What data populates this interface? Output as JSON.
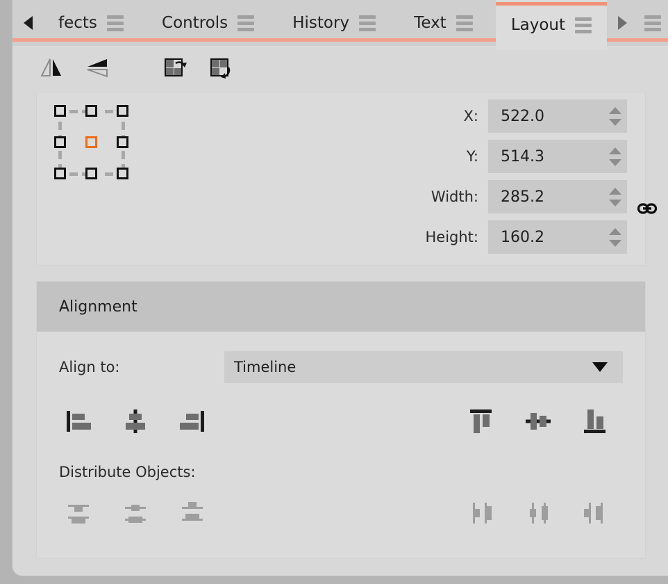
{
  "tabbar": {
    "prev_arrow_icon": "triangle-left-icon",
    "next_arrow_icon": "triangle-right-icon",
    "tabs": [
      {
        "label": "fects",
        "menu_icon": "hamburger-menu-icon",
        "active": false
      },
      {
        "label": "Controls",
        "menu_icon": "hamburger-menu-icon",
        "active": false
      },
      {
        "label": "History",
        "menu_icon": "hamburger-menu-icon",
        "active": false
      },
      {
        "label": "Text",
        "menu_icon": "hamburger-menu-icon",
        "active": false
      },
      {
        "label": "Layout",
        "menu_icon": "hamburger-menu-icon",
        "active": true
      }
    ],
    "overflow_menu_icon": "hamburger-menu-icon",
    "accent_color": "#f2907a"
  },
  "transform_toolbar": {
    "buttons": [
      {
        "name": "flip-horizontal-button",
        "icon": "flip-horizontal-icon"
      },
      {
        "name": "flip-vertical-button",
        "icon": "flip-vertical-icon"
      },
      {
        "name": "rotate-clockwise-button",
        "icon": "rotate-cw-icon"
      },
      {
        "name": "rotate-counterclockwise-button",
        "icon": "rotate-ccw-icon"
      }
    ]
  },
  "transform_panel": {
    "anchor": {
      "selected": "center",
      "selected_color": "#ef6c15",
      "cells": [
        "top-left",
        "top-center",
        "top-right",
        "middle-left",
        "center",
        "middle-right",
        "bottom-left",
        "bottom-center",
        "bottom-right"
      ]
    },
    "fields": [
      {
        "label": "X:",
        "value": "522.0",
        "name": "x-field"
      },
      {
        "label": "Y:",
        "value": "514.3",
        "name": "y-field"
      },
      {
        "label": "Width:",
        "value": "285.2",
        "name": "width-field"
      },
      {
        "label": "Height:",
        "value": "160.2",
        "name": "height-field"
      }
    ],
    "link_icon": "chain-link-icon"
  },
  "alignment": {
    "title": "Alignment",
    "align_to_label": "Align to:",
    "align_to_value": "Timeline",
    "dropdown_icon": "chevron-down-icon",
    "align_buttons_left": [
      {
        "name": "align-left-button",
        "icon": "align-left-icon"
      },
      {
        "name": "align-horizontal-center-button",
        "icon": "align-center-horizontal-icon"
      },
      {
        "name": "align-right-button",
        "icon": "align-right-icon"
      }
    ],
    "align_buttons_right": [
      {
        "name": "align-top-button",
        "icon": "align-top-icon"
      },
      {
        "name": "align-vertical-center-button",
        "icon": "align-center-vertical-icon"
      },
      {
        "name": "align-bottom-button",
        "icon": "align-bottom-icon"
      }
    ],
    "distribute_label": "Distribute Objects:",
    "distribute_buttons_left": [
      {
        "name": "distribute-top-edges-button",
        "icon": "distribute-top-icon",
        "disabled": true
      },
      {
        "name": "distribute-vertical-centers-button",
        "icon": "distribute-middle-icon",
        "disabled": true
      },
      {
        "name": "distribute-bottom-edges-button",
        "icon": "distribute-bottom-icon",
        "disabled": true
      }
    ],
    "distribute_buttons_right": [
      {
        "name": "distribute-left-edges-button",
        "icon": "distribute-left-icon",
        "disabled": true
      },
      {
        "name": "distribute-horizontal-centers-button",
        "icon": "distribute-center-icon",
        "disabled": true
      },
      {
        "name": "distribute-right-edges-button",
        "icon": "distribute-right-icon",
        "disabled": true
      }
    ]
  }
}
